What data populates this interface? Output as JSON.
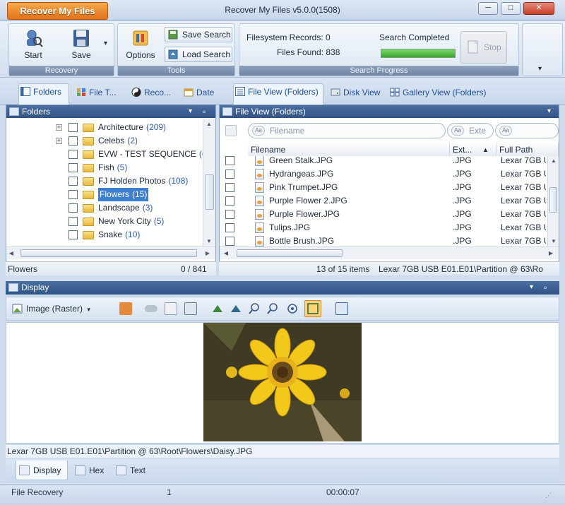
{
  "window": {
    "app_menu_label": "Recover My Files",
    "title": "Recover My Files v5.0.0(1508)",
    "min": "─",
    "max": "□",
    "close": "✕"
  },
  "ribbon": {
    "recovery": {
      "label": "Recovery",
      "start": "Start",
      "save": "Save",
      "save_dropdown": "▾"
    },
    "tools": {
      "label": "Tools",
      "options": "Options",
      "save_search": "Save Search",
      "load_search": "Load Search"
    },
    "search_progress": {
      "label": "Search Progress",
      "filesystem_records_label": "Filesystem Records: 0",
      "files_found_label": "Files Found: 838",
      "status": "Search Completed",
      "progress_fraction": 1.0,
      "stop": "Stop"
    },
    "collapse": "▾"
  },
  "tabs": {
    "folders": "Folders",
    "file_type": "File T...",
    "recovery": "Reco...",
    "date": "Date",
    "file_view_folders": "File View (Folders)",
    "disk_view": "Disk View",
    "gallery_view_folders": "Gallery View (Folders)"
  },
  "folders_pane": {
    "title": "Folders",
    "dropdown": "▾",
    "pin": "▫",
    "items": [
      {
        "name": "Architecture",
        "count": "(209)",
        "expandable": true,
        "selected": false
      },
      {
        "name": "Celebs",
        "count": "(2)",
        "expandable": true,
        "selected": false
      },
      {
        "name": "EVW - TEST SEQUENCE",
        "count": "(6",
        "expandable": false,
        "selected": false
      },
      {
        "name": "Fish",
        "count": "(5)",
        "expandable": false,
        "selected": false
      },
      {
        "name": "FJ Holden Photos",
        "count": "(108)",
        "expandable": false,
        "selected": false
      },
      {
        "name": "Flowers",
        "count": "(15)",
        "expandable": false,
        "selected": true
      },
      {
        "name": "Landscape",
        "count": "(3)",
        "expandable": false,
        "selected": false
      },
      {
        "name": "New York City",
        "count": "(5)",
        "expandable": false,
        "selected": false
      },
      {
        "name": "Snake",
        "count": "(10)",
        "expandable": false,
        "selected": false
      }
    ],
    "status_left": "Flowers",
    "status_right": "0 / 841"
  },
  "file_view": {
    "title": "File View (Folders)",
    "dropdown": "▾",
    "filters": {
      "filename": "Filename",
      "ext": "Exte",
      "filter_icon": "Aa"
    },
    "columns": {
      "filename": "Filename",
      "ext": "Ext...",
      "sort": "▲",
      "full_path": "Full Path"
    },
    "rows": [
      {
        "name": "Green Stalk.JPG",
        "ext": ".JPG",
        "path": "Lexar 7GB U"
      },
      {
        "name": "Hydrangeas.JPG",
        "ext": ".JPG",
        "path": "Lexar 7GB U"
      },
      {
        "name": "Pink Trumpet.JPG",
        "ext": ".JPG",
        "path": "Lexar 7GB U"
      },
      {
        "name": "Purple Flower 2.JPG",
        "ext": ".JPG",
        "path": "Lexar 7GB U"
      },
      {
        "name": "Purple Flower.JPG",
        "ext": ".JPG",
        "path": "Lexar 7GB U"
      },
      {
        "name": "Tulips.JPG",
        "ext": ".JPG",
        "path": "Lexar 7GB U"
      },
      {
        "name": "Bottle Brush.JPG",
        "ext": ".JPG",
        "path": "Lexar 7GB U"
      }
    ],
    "status_count": "13 of 15 items",
    "status_path": "Lexar 7GB USB E01.E01\\Partition @ 63\\Ro"
  },
  "display": {
    "title": "Display",
    "dropdown": "▾",
    "pin": "▫",
    "mode": "Image (Raster)",
    "mode_dropdown": "▾",
    "path": "Lexar 7GB USB E01.E01\\Partition @ 63\\Root\\Flowers\\Daisy.JPG",
    "tabs": {
      "display": "Display",
      "hex": "Hex",
      "text": "Text"
    }
  },
  "statusbar": {
    "mode": "File Recovery",
    "count": "1",
    "elapsed": "00:00:07"
  },
  "colors": {
    "accent_orange": "#e0731a",
    "pane_header": "#2f5386",
    "selection": "#3d7fd3",
    "progress_green": "#37a52a",
    "link_count": "#2c5fb3"
  }
}
